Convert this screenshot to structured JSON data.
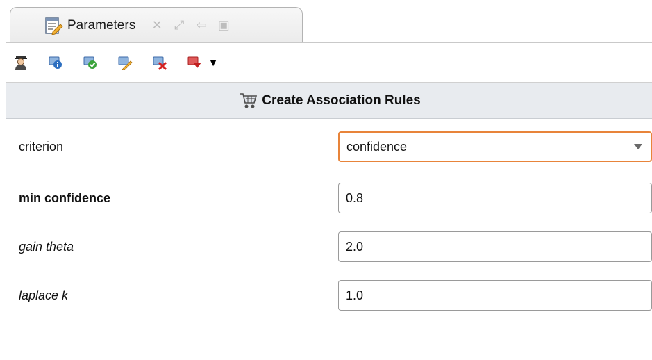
{
  "tab": {
    "title": "Parameters",
    "controls": [
      {
        "name": "close-view-icon",
        "glyph": "✕"
      },
      {
        "name": "maximize-view-icon",
        "glyph": "⤢"
      },
      {
        "name": "dock-view-icon",
        "glyph": "⇦"
      },
      {
        "name": "restore-view-icon",
        "glyph": "▣"
      }
    ]
  },
  "toolbar": {
    "buttons": [
      {
        "name": "expert-mode-icon"
      },
      {
        "name": "operator-info-icon"
      },
      {
        "name": "enable-operator-icon"
      },
      {
        "name": "rename-operator-icon"
      },
      {
        "name": "delete-operator-icon"
      },
      {
        "name": "operator-menu-icon"
      }
    ],
    "dropdown_glyph": "▼"
  },
  "operator": {
    "title": "Create Association Rules",
    "icon": "cart-icon"
  },
  "parameters": [
    {
      "label": "criterion",
      "value": "confidence",
      "type": "select",
      "style": "normal"
    },
    {
      "label": "min confidence",
      "value": "0.8",
      "type": "text",
      "style": "bold"
    },
    {
      "label": "gain theta",
      "value": "2.0",
      "type": "text",
      "style": "italic"
    },
    {
      "label": "laplace k",
      "value": "1.0",
      "type": "text",
      "style": "italic"
    }
  ],
  "colors": {
    "focus_border": "#e8843a",
    "header_bg": "#e8ebef"
  }
}
